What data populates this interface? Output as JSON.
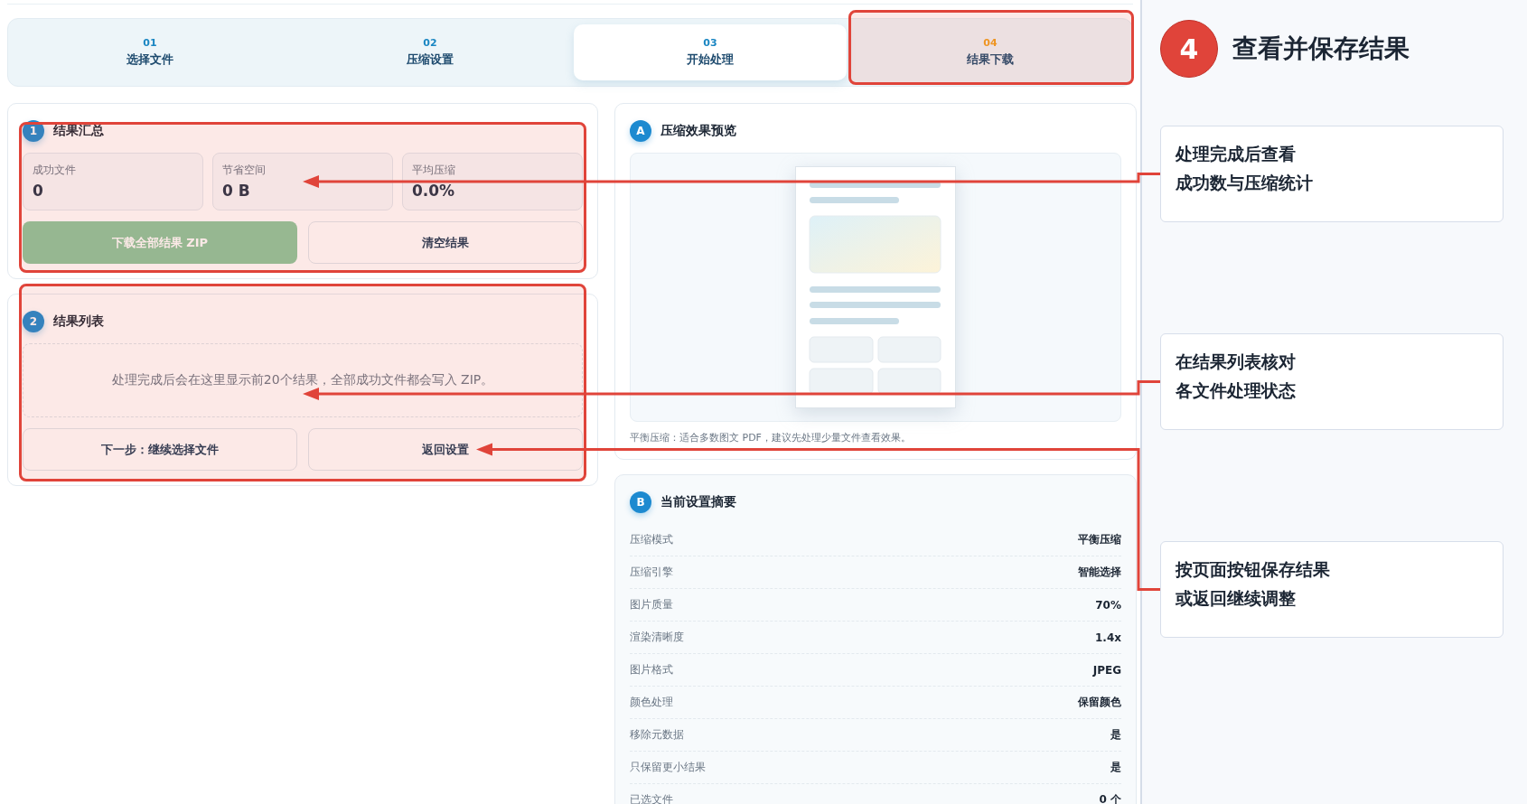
{
  "tabs": [
    {
      "number": "01",
      "label": "选择文件",
      "selected": false,
      "current": false,
      "highlighted": false
    },
    {
      "number": "02",
      "label": "压缩设置",
      "selected": false,
      "current": false,
      "highlighted": false
    },
    {
      "number": "03",
      "label": "开始处理",
      "selected": true,
      "current": false,
      "highlighted": false
    },
    {
      "number": "04",
      "label": "结果下载",
      "selected": false,
      "current": true,
      "highlighted": true
    }
  ],
  "summary": {
    "badge": "1",
    "title": "结果汇总",
    "highlighted": true,
    "stats": [
      {
        "label": "成功文件",
        "value": "0"
      },
      {
        "label": "节省空间",
        "value": "0 B"
      },
      {
        "label": "平均压缩",
        "value": "0.0%"
      }
    ],
    "buttons": [
      {
        "label": "下载全部结果 ZIP",
        "kind": "primary",
        "disabled": true
      },
      {
        "label": "清空结果",
        "kind": "secondary",
        "disabled": false
      }
    ]
  },
  "results": {
    "badge": "2",
    "title": "结果列表",
    "highlighted": true,
    "empty_text": "处理完成后会在这里显示前20个结果，全部成功文件都会写入 ZIP。",
    "buttons": [
      {
        "label": "下一步：继续选择文件",
        "kind": "secondary",
        "disabled": false
      },
      {
        "label": "返回设置",
        "kind": "secondary",
        "disabled": false
      }
    ]
  },
  "preview": {
    "badge": "A",
    "title": "压缩效果预览",
    "caption": "平衡压缩：适合多数图文 PDF，建议先处理少量文件查看效果。"
  },
  "settings": {
    "badge": "B",
    "title": "当前设置摘要",
    "rows": [
      {
        "label": "压缩模式",
        "value": "平衡压缩"
      },
      {
        "label": "压缩引擎",
        "value": "智能选择"
      },
      {
        "label": "图片质量",
        "value": "70%"
      },
      {
        "label": "渲染清晰度",
        "value": "1.4x"
      },
      {
        "label": "图片格式",
        "value": "JPEG"
      },
      {
        "label": "颜色处理",
        "value": "保留颜色"
      },
      {
        "label": "移除元数据",
        "value": "是"
      },
      {
        "label": "只保留更小结果",
        "value": "是"
      },
      {
        "label": "已选文件",
        "value": "0 个"
      }
    ]
  },
  "guide": {
    "step": "4",
    "title": "查看并保存结果",
    "notes": [
      {
        "lines": [
          "处理完成后查看",
          "成功数与压缩统计"
        ]
      },
      {
        "lines": [
          "在结果列表核对",
          "各文件处理状态"
        ]
      },
      {
        "lines": [
          "按页面按钮保存结果",
          "或返回继续调整"
        ]
      }
    ]
  }
}
